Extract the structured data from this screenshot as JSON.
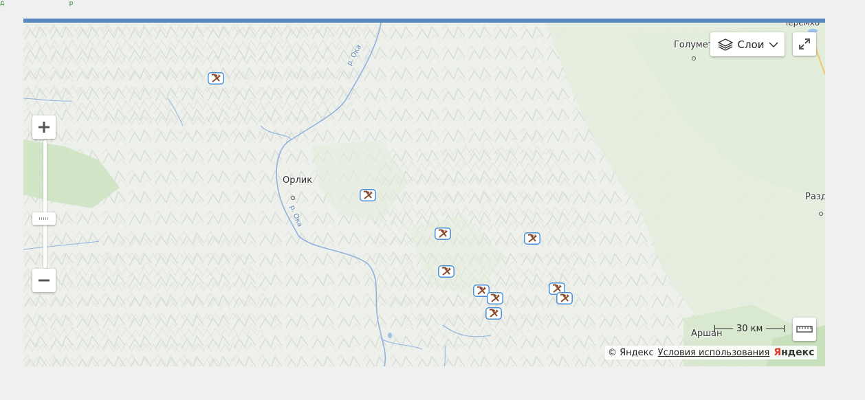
{
  "map": {
    "place_labels": [
      {
        "id": "golumet",
        "text": "Голумет"
      },
      {
        "id": "orlik",
        "text": "Орлик"
      },
      {
        "id": "razd",
        "text": "Разд"
      },
      {
        "id": "arshan",
        "text": "Аршан"
      },
      {
        "id": "cheremkh",
        "text": "Черемхо"
      }
    ],
    "river_labels": [
      {
        "id": "oka-north",
        "text": "р. Ока"
      },
      {
        "id": "oka-south",
        "text": "р. Ока"
      }
    ],
    "markers": [
      {
        "id": "m1",
        "type": "mine"
      },
      {
        "id": "m2",
        "type": "mine"
      },
      {
        "id": "m3",
        "type": "mine"
      },
      {
        "id": "m4",
        "type": "mine"
      },
      {
        "id": "m5",
        "type": "mine"
      },
      {
        "id": "m6",
        "type": "mine"
      },
      {
        "id": "m7",
        "type": "mine"
      },
      {
        "id": "m8",
        "type": "mine"
      },
      {
        "id": "m9",
        "type": "mine"
      },
      {
        "id": "m10",
        "type": "mine"
      }
    ],
    "colors": {
      "top_bar": "#5b88bf",
      "river": "#8fb3de",
      "marker_border": "#4a90d9",
      "marker_icon": "#8a4a2a"
    }
  },
  "controls": {
    "zoom_in_icon": "plus-icon",
    "zoom_out_icon": "minus-icon",
    "layers_label": "Слои",
    "layers_icon": "layers-icon",
    "fullscreen_icon": "expand-icon",
    "ruler_icon": "ruler-icon"
  },
  "scale": {
    "label": "30 км"
  },
  "footer": {
    "copyright": "© Яндекс",
    "terms": "Условия использования",
    "logo_first": "Я",
    "logo_rest": "ндекс"
  }
}
